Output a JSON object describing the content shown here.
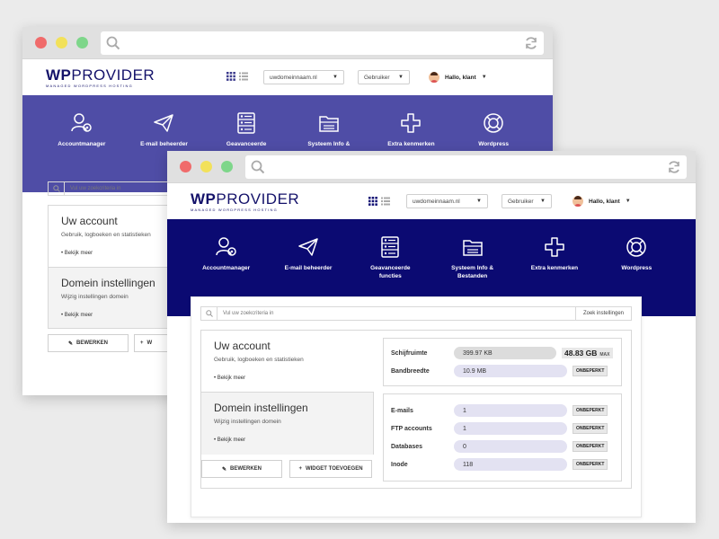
{
  "back_window": {
    "logo": {
      "wp": "WP",
      "rest": "PROVIDER",
      "tagline": "MANAGED WORDPRESS HOSTING"
    },
    "domain_select": "uwdomeinnaam.nl",
    "user_select": "Gebruiker",
    "greeting": "Hallo, klant",
    "nav": [
      {
        "label": "Accountmanager",
        "icon": "account-manager-icon"
      },
      {
        "label": "E-mail beheerder",
        "icon": "paper-plane-icon"
      },
      {
        "label": "Geavanceerde",
        "icon": "server-icon"
      },
      {
        "label": "Systeem Info &",
        "icon": "folder-icon"
      },
      {
        "label": "Extra kenmerken",
        "icon": "plus-icon"
      },
      {
        "label": "Wordpress",
        "icon": "lifebuoy-icon"
      }
    ],
    "search_placeholder": "Vul uw zoekcriteria in",
    "account": {
      "title": "Uw account",
      "subtitle": "Gebruik, logboeken en statistieken",
      "link": "• Bekijk meer"
    },
    "domain": {
      "title": "Domein instellingen",
      "subtitle": "Wijzig instellingen domein",
      "link": "• Bekijk meer"
    },
    "edit_button": "BEWERKEN",
    "widget_button_partial": "W"
  },
  "front_window": {
    "logo": {
      "wp": "WP",
      "rest": "PROVIDER",
      "tagline": "MANAGED WORDPRESS HOSTING"
    },
    "domain_select": "uwdomeinnaam.nl",
    "user_select": "Gebruiker",
    "greeting": "Hallo, klant",
    "nav": [
      {
        "label": "Accountmanager",
        "label2": "",
        "icon": "account-manager-icon"
      },
      {
        "label": "E-mail beheerder",
        "label2": "",
        "icon": "paper-plane-icon"
      },
      {
        "label": "Geavanceerde",
        "label2": "functies",
        "icon": "server-icon"
      },
      {
        "label": "Systeem Info &",
        "label2": "Bestanden",
        "icon": "folder-icon"
      },
      {
        "label": "Extra kenmerken",
        "label2": "",
        "icon": "plus-icon"
      },
      {
        "label": "Wordpress",
        "label2": "",
        "icon": "lifebuoy-icon"
      }
    ],
    "search_placeholder": "Vul uw zoekcriteria in",
    "search_button": "Zoek instellingen",
    "account": {
      "title": "Uw account",
      "subtitle": "Gebruik, logboeken en statistieken",
      "link": "• Bekijk meer"
    },
    "domain": {
      "title": "Domein instellingen",
      "subtitle": "Wijzig instellingen domein",
      "link": "• Bekijk meer"
    },
    "edit_button": "BEWERKEN",
    "widget_button": "WIDGET TOEVOEGEN",
    "usage": {
      "disk_label": "Schijfruimte",
      "disk_value": "399.97 KB",
      "disk_max": "48.83 GB",
      "disk_max_unit": "MAX",
      "bandwidth_label": "Bandbreedte",
      "bandwidth_value": "10.9 MB",
      "bandwidth_badge": "ONBEPERKT"
    },
    "limits": [
      {
        "label": "E-mails",
        "value": "1",
        "badge": "ONBEPERKT"
      },
      {
        "label": "FTP accounts",
        "value": "1",
        "badge": "ONBEPERKT"
      },
      {
        "label": "Databases",
        "value": "0",
        "badge": "ONBEPERKT"
      },
      {
        "label": "Inode",
        "value": "118",
        "badge": "ONBEPERKT"
      }
    ]
  },
  "colors": {
    "back_band": "#4f4da6",
    "front_band": "#0b0a72",
    "logo": "#14126a"
  }
}
